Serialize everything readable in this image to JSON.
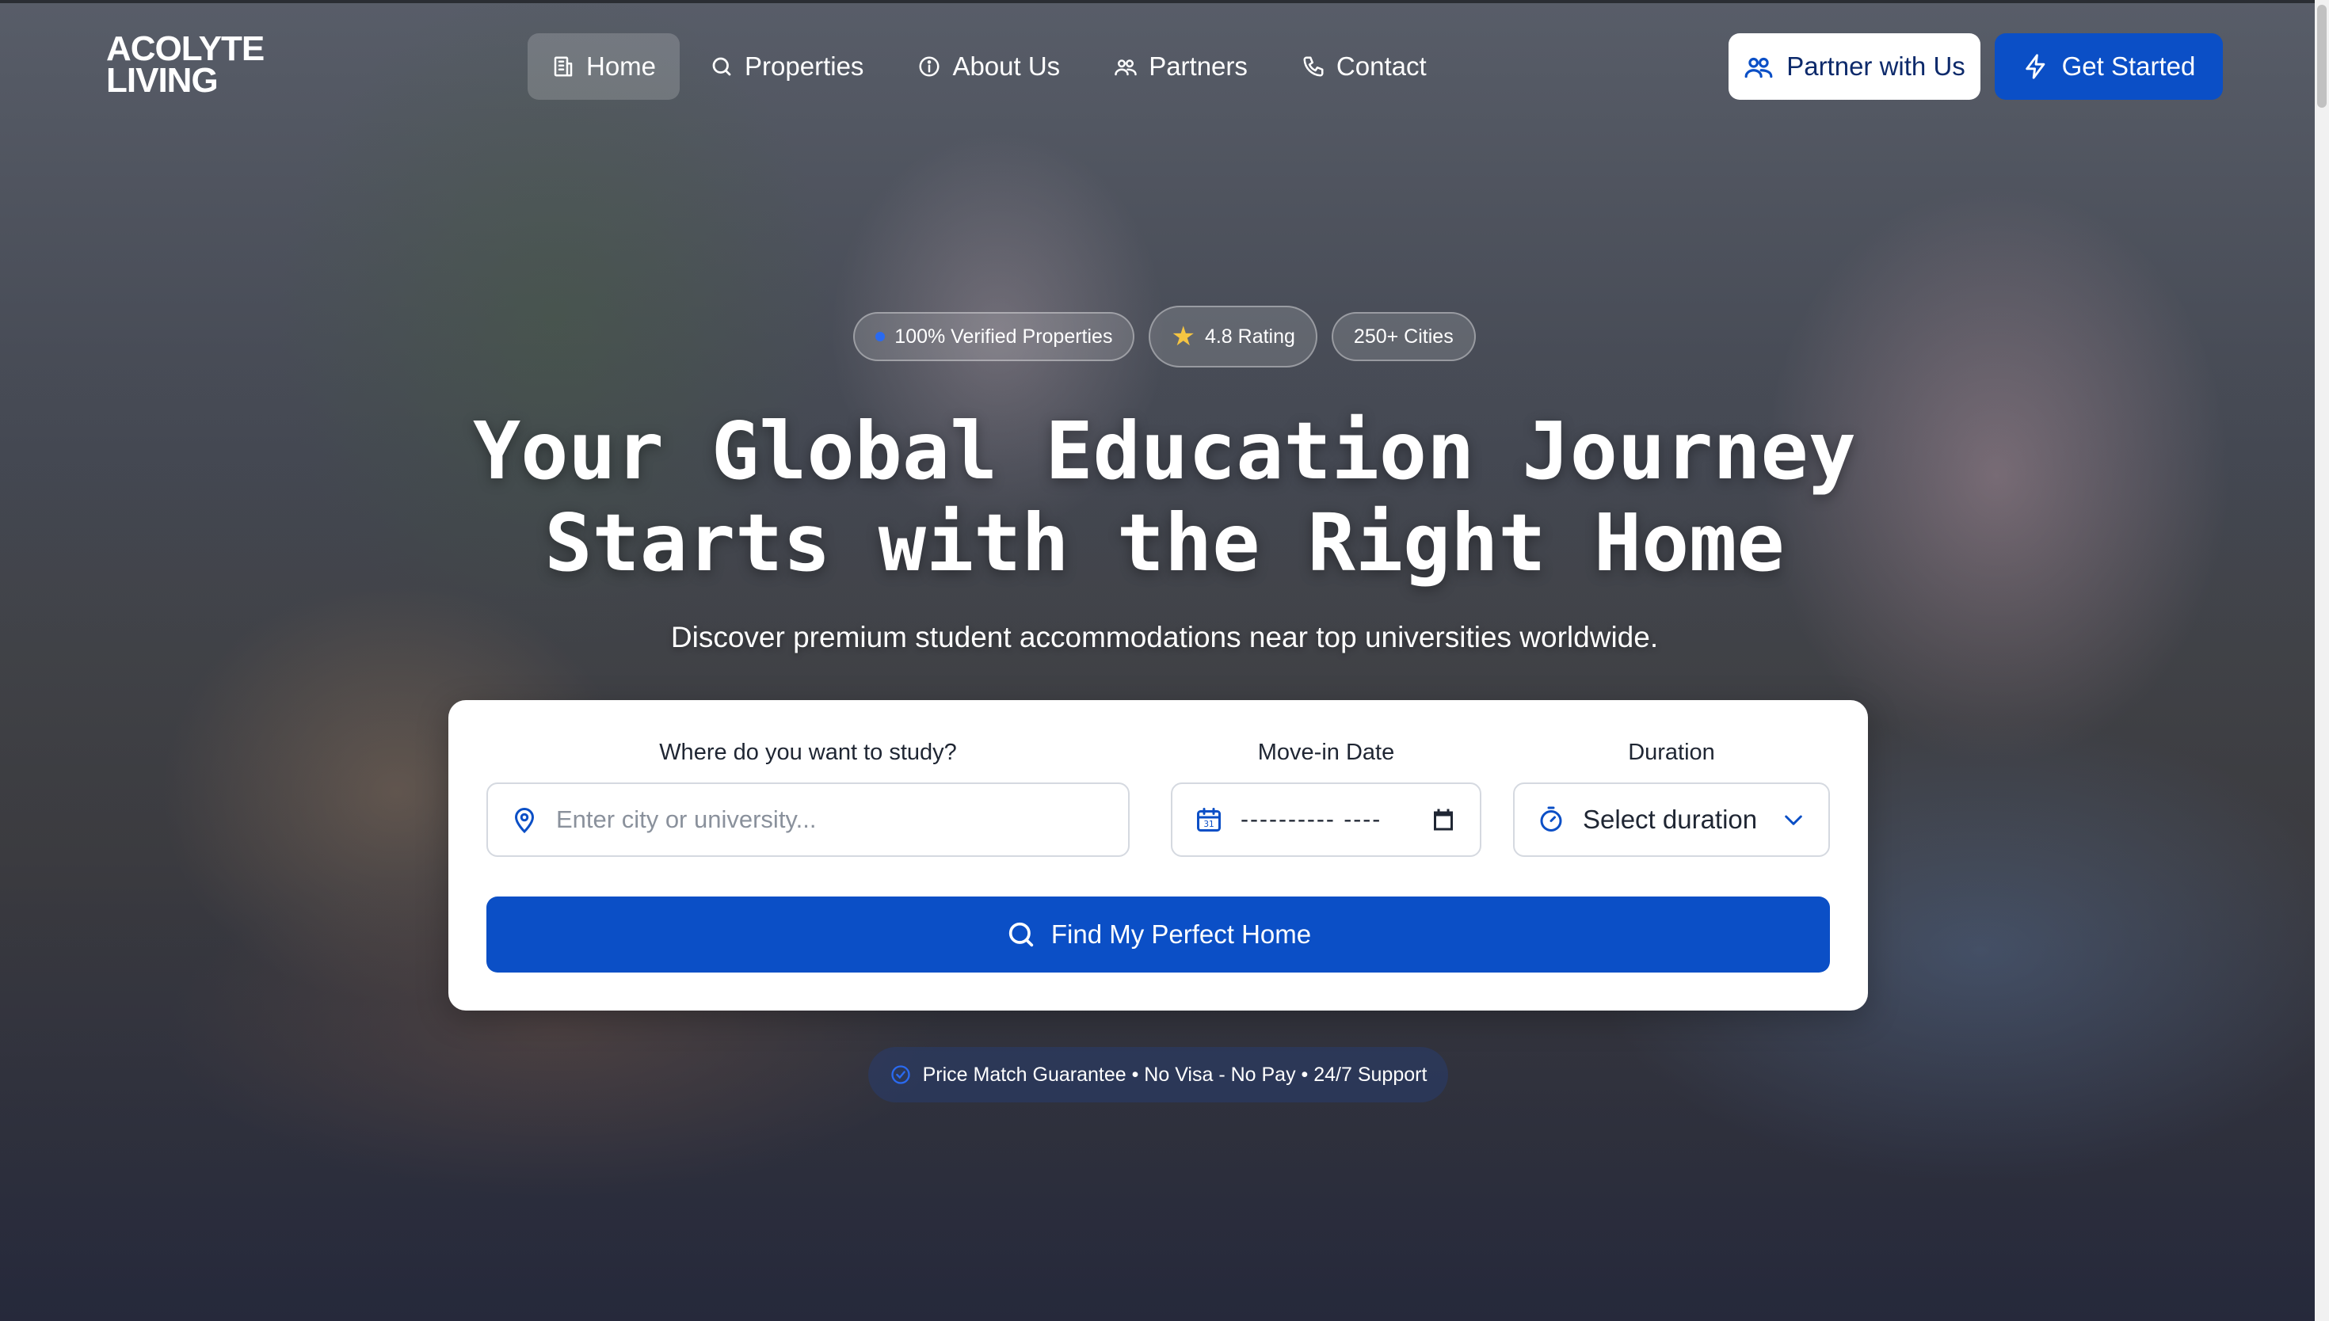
{
  "brand": {
    "line1": "ACOLYTE",
    "line2": "LIVING"
  },
  "nav": {
    "items": [
      {
        "label": "Home",
        "icon": "building-icon",
        "active": true
      },
      {
        "label": "Properties",
        "icon": "search-icon"
      },
      {
        "label": "About Us",
        "icon": "info-icon"
      },
      {
        "label": "Partners",
        "icon": "users-icon"
      },
      {
        "label": "Contact",
        "icon": "phone-icon"
      }
    ]
  },
  "header_actions": {
    "partner_label": "Partner with Us",
    "start_label": "Get Started"
  },
  "badges": {
    "verified": "100% Verified Properties",
    "rating": "4.8 Rating",
    "cities": "250+ Cities"
  },
  "hero": {
    "title_line1": "Your Global Education Journey",
    "title_line2": "Starts with the Right Home",
    "subtitle": "Discover premium student accommodations near top universities worldwide."
  },
  "search": {
    "location_label": "Where do you want to study?",
    "location_placeholder": "Enter city or university...",
    "date_label": "Move-in Date",
    "date_value": "---------- ----",
    "duration_label": "Duration",
    "duration_value": "Select duration",
    "submit_label": "Find My Perfect Home"
  },
  "guarantee": "Price Match Guarantee • No Visa - No Pay • 24/7 Support",
  "colors": {
    "accent": "#0b4fc6",
    "text_dark": "#1f2633",
    "card_bg": "#ffffff"
  }
}
